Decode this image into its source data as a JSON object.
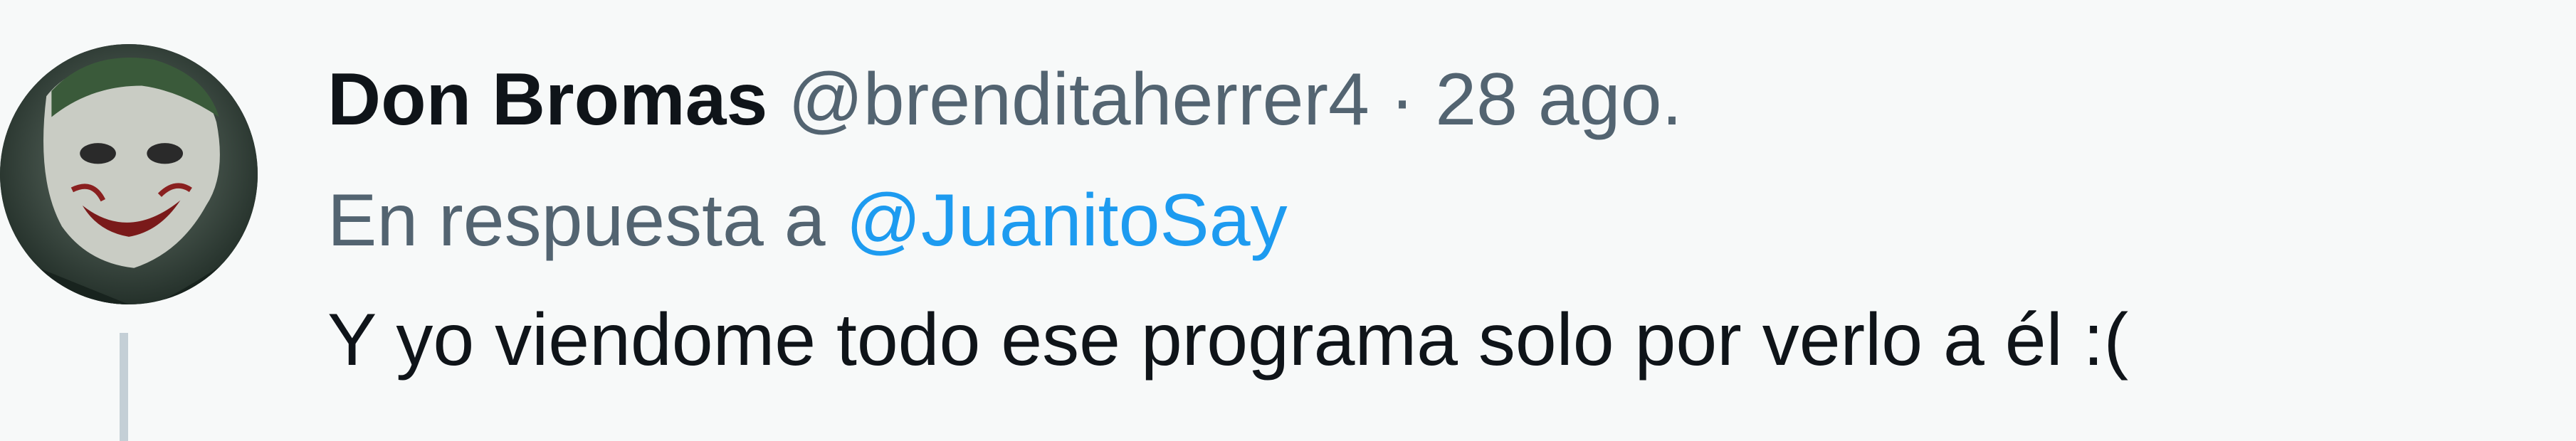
{
  "tweet": {
    "author": {
      "display_name": "Don Bromas",
      "handle": "@brenditaherrer4",
      "avatar_icon": "joker-avatar-icon"
    },
    "separator": "·",
    "date": "28 ago.",
    "reply": {
      "prefix": "En respuesta a",
      "mention": "@JuanitoSay"
    },
    "text": "Y yo viendome todo ese programa solo por verlo a él :("
  },
  "colors": {
    "background": "#f7f9f9",
    "text_primary": "#0f1419",
    "text_secondary": "#536471",
    "link": "#1d9bf0",
    "thread_line": "#c4cfd6"
  }
}
